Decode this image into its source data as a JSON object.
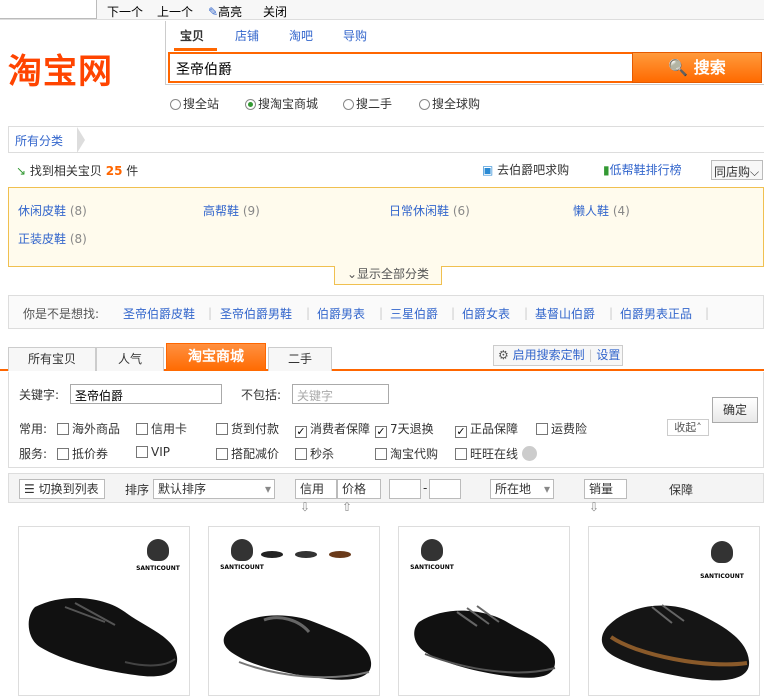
{
  "toolbar": {
    "next": "下一个",
    "prev": "上一个",
    "highlight": "高亮",
    "close": "关闭"
  },
  "logo": "淘宝网",
  "search": {
    "tabs": [
      "宝贝",
      "店铺",
      "淘吧",
      "导购"
    ],
    "value": "圣帝伯爵",
    "button": "搜索",
    "scopes": [
      "搜全站",
      "搜淘宝商城",
      "搜二手",
      "搜全球购"
    ]
  },
  "breadcrumb": "所有分类",
  "found": {
    "prefix": "找到相关宝贝",
    "count": "25",
    "suffix": "件"
  },
  "links": {
    "bar": "去伯爵吧求购",
    "rank": "低帮鞋排行榜",
    "same_store": "同店购"
  },
  "categories": [
    {
      "name": "休闲皮鞋",
      "count": "(8)"
    },
    {
      "name": "高帮鞋",
      "count": "(9)"
    },
    {
      "name": "日常休闲鞋",
      "count": "(6)"
    },
    {
      "name": "懒人鞋",
      "count": "(4)"
    },
    {
      "name": "正装皮鞋",
      "count": "(8)"
    }
  ],
  "show_all": "显示全部分类",
  "suggest": {
    "label": "你是不是想找:",
    "items": [
      "圣帝伯爵皮鞋",
      "圣帝伯爵男鞋",
      "伯爵男表",
      "三星伯爵",
      "伯爵女表",
      "基督山伯爵",
      "伯爵男表正品"
    ]
  },
  "product_tabs": [
    "所有宝贝",
    "人气",
    "淘宝商城",
    "二手"
  ],
  "custom_search": {
    "enable": "启用搜索定制",
    "settings": "设置"
  },
  "filter": {
    "keyword_label": "关键字:",
    "keyword_value": "圣帝伯爵",
    "exclude_label": "不包括:",
    "exclude_placeholder": "关键字",
    "common_label": "常用:",
    "service_label": "服务:",
    "common": [
      {
        "label": "海外商品",
        "checked": false
      },
      {
        "label": "信用卡",
        "checked": false
      },
      {
        "label": "货到付款",
        "checked": false
      },
      {
        "label": "消费者保障",
        "checked": true
      },
      {
        "label": "7天退换",
        "checked": true
      },
      {
        "label": "正品保障",
        "checked": true
      },
      {
        "label": "运费险",
        "checked": false
      }
    ],
    "service": [
      {
        "label": "抵价券",
        "checked": false
      },
      {
        "label": "VIP",
        "checked": false
      },
      {
        "label": "搭配减价",
        "checked": false
      },
      {
        "label": "秒杀",
        "checked": false
      },
      {
        "label": "淘宝代购",
        "checked": false
      },
      {
        "label": "旺旺在线",
        "checked": false
      }
    ],
    "ok": "确定",
    "collapse": "收起"
  },
  "sort": {
    "list_view": "切换到列表",
    "sort_label": "排序",
    "sort_value": "默认排序",
    "credit": "信用",
    "price": "价格",
    "range_sep": "-",
    "location": "所在地",
    "sales": "销量",
    "guarantee": "保障"
  },
  "brand": "SANTICOUNT",
  "colors": {
    "accent": "#ff6a00",
    "link": "#3366cc",
    "logo": "#ff4400"
  }
}
